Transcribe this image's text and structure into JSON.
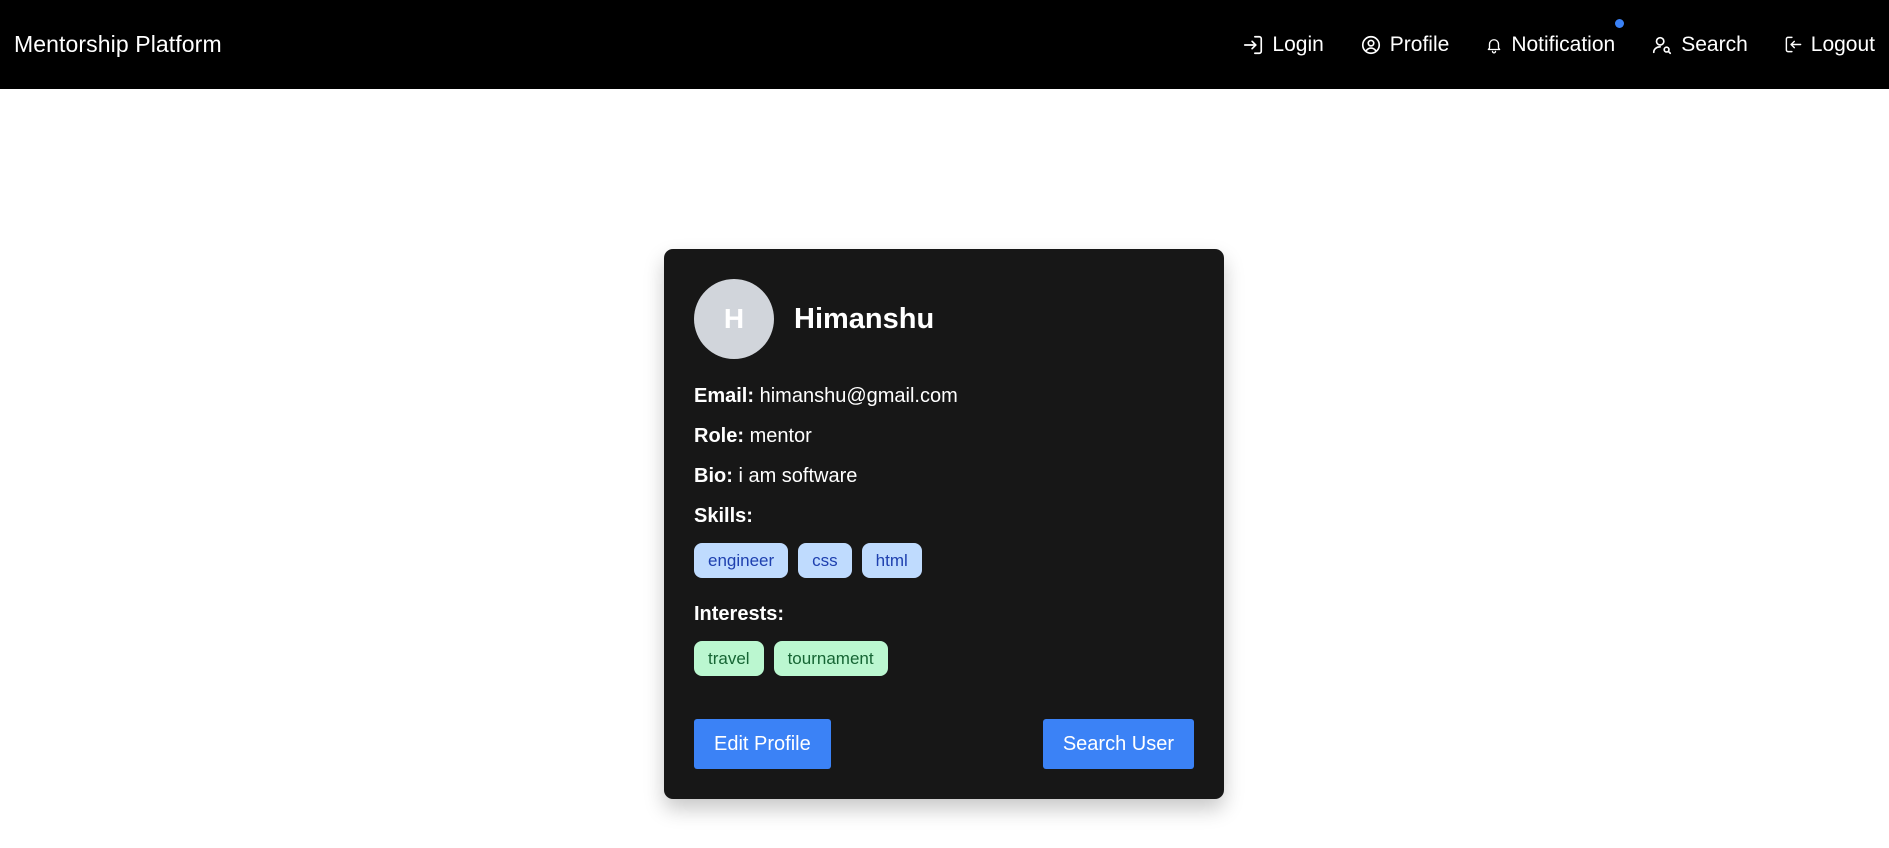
{
  "navbar": {
    "brand": "Mentorship Platform",
    "links": [
      {
        "label": "Login",
        "icon": "login-icon"
      },
      {
        "label": "Profile",
        "icon": "user-circle-icon"
      },
      {
        "label": "Notification",
        "icon": "bell-icon",
        "has_badge": true
      },
      {
        "label": "Search",
        "icon": "user-search-icon"
      },
      {
        "label": "Logout",
        "icon": "logout-icon"
      }
    ]
  },
  "profile": {
    "avatar_initial": "H",
    "name": "Himanshu",
    "email_label": "Email:",
    "email": "himanshu@gmail.com",
    "role_label": "Role:",
    "role": "mentor",
    "bio_label": "Bio:",
    "bio": "i am software",
    "skills_label": "Skills:",
    "skills": [
      "engineer",
      "css",
      "html"
    ],
    "interests_label": "Interests:",
    "interests": [
      "travel",
      "tournament"
    ]
  },
  "actions": {
    "edit_label": "Edit Profile",
    "search_label": "Search User"
  },
  "colors": {
    "navbar_bg": "#000000",
    "card_bg": "#171717",
    "accent": "#3b82f6",
    "skill_chip_bg": "#bfdbfe",
    "interest_chip_bg": "#bbf7d0"
  }
}
